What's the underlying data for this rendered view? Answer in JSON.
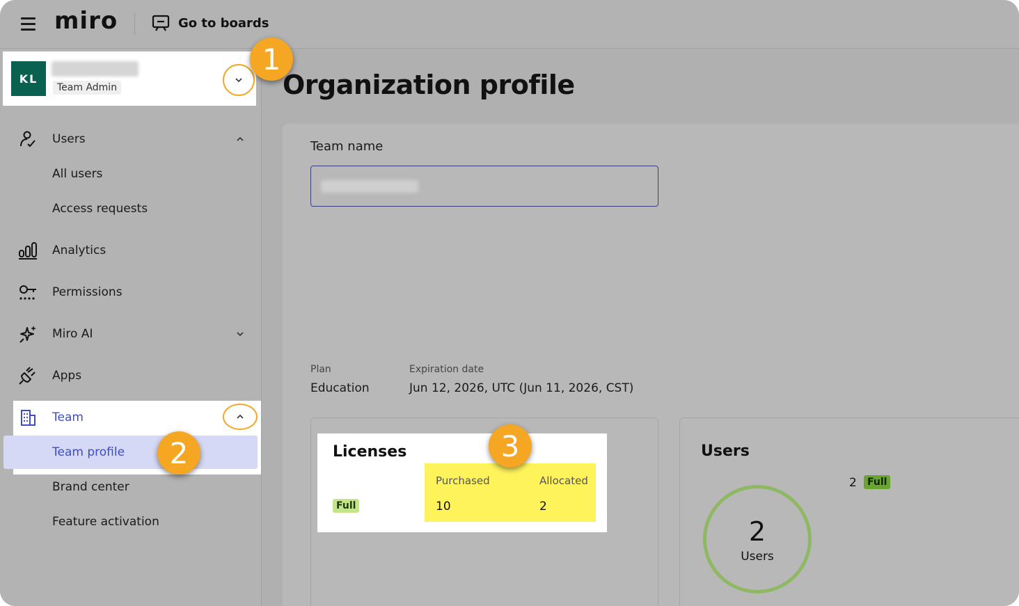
{
  "header": {
    "logo": "miro",
    "goto_boards": "Go to boards"
  },
  "team_switcher": {
    "avatar_initials": "KL",
    "team_name": "",
    "role": "Team Admin"
  },
  "sidebar": {
    "items": [
      {
        "label": "Users",
        "icon": "user-icon",
        "expanded": true
      },
      {
        "label": "All users"
      },
      {
        "label": "Access requests"
      },
      {
        "label": "Analytics",
        "icon": "bar-chart-icon"
      },
      {
        "label": "Permissions",
        "icon": "key-icon"
      },
      {
        "label": "Miro AI",
        "icon": "sparkle-icon",
        "expanded": false
      },
      {
        "label": "Apps",
        "icon": "plug-icon"
      },
      {
        "label": "Team",
        "icon": "building-icon",
        "expanded": true
      },
      {
        "label": "Team profile",
        "selected": true
      },
      {
        "label": "Brand center"
      },
      {
        "label": "Feature activation"
      }
    ]
  },
  "callouts": [
    "1",
    "2",
    "3"
  ],
  "main": {
    "title": "Organization profile",
    "team_name_label": "Team name",
    "team_name_value": "",
    "plan_label": "Plan",
    "plan_value": "Education",
    "expiration_label": "Expiration date",
    "expiration_value": "Jun 12, 2026, UTC (Jun 11, 2026, CST)"
  },
  "licenses": {
    "title": "Licenses",
    "type_badge": "Full",
    "purchased_label": "Purchased",
    "purchased_value": "10",
    "allocated_label": "Allocated",
    "allocated_value": "2"
  },
  "users_card": {
    "title": "Users",
    "count": "2",
    "badge": "Full",
    "ring_count": "2",
    "ring_label": "Users"
  },
  "colors": {
    "accent_orange": "#f5a623",
    "team_avatar": "#0b6150",
    "highlight_yellow": "#fff35c",
    "selected_nav": "#d6d9f5",
    "users_ring": "#8fb864"
  }
}
